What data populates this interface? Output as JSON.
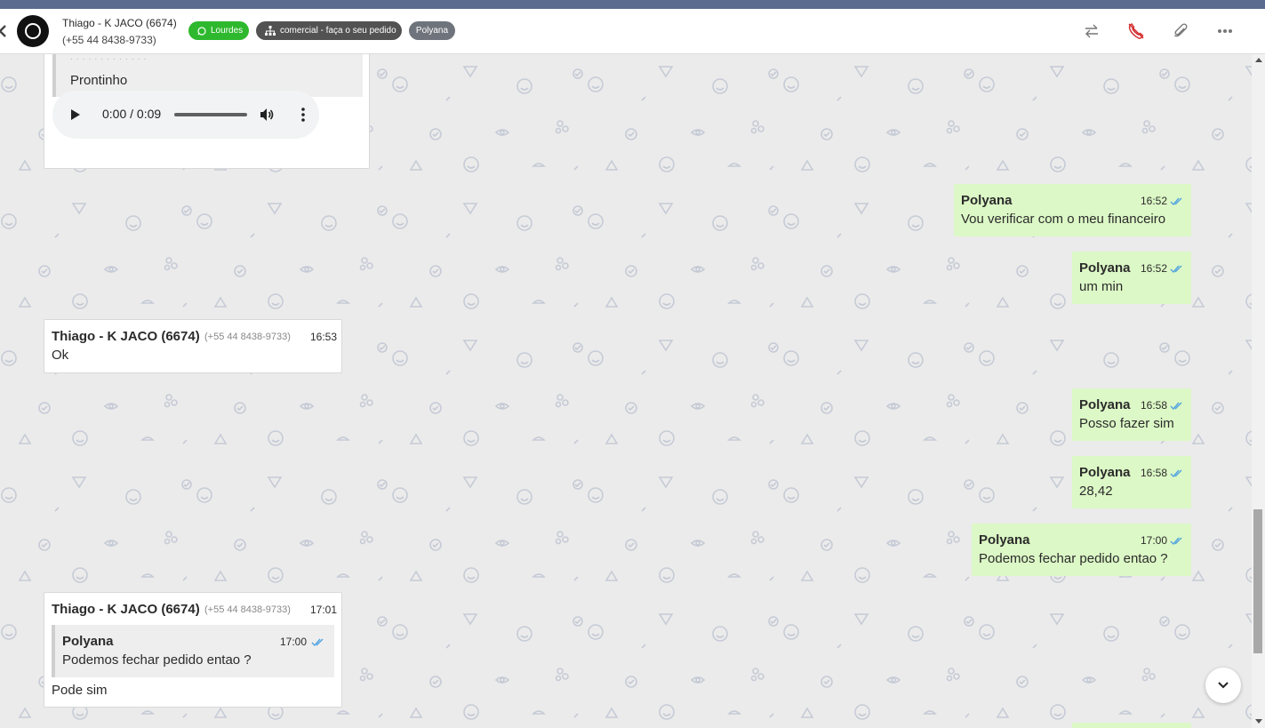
{
  "header": {
    "contact_name": "Thiago - K JACO (6674)",
    "contact_phone": "(+55 44 8438-9733)",
    "badges": {
      "connection": "Lourdes",
      "queue": "comercial - faça o seu pedido",
      "user": "Polyana"
    },
    "actions": [
      "transfer-icon",
      "end-call-icon",
      "paperclip-icon",
      "more-icon"
    ]
  },
  "colors": {
    "outgoing_bubble": "#dcf8c6",
    "incoming_bubble": "#ffffff",
    "read_ticks": "#4fa3e0",
    "whatsapp_badge": "#2eb82e"
  },
  "messages": [
    {
      "id": "m0",
      "direction": "in",
      "quote_text": "Prontinho",
      "audio_time": "0:00 / 0:09"
    },
    {
      "id": "m1",
      "direction": "out",
      "sender": "Polyana",
      "time": "16:52",
      "text": "Vou verificar com o meu financeiro"
    },
    {
      "id": "m2",
      "direction": "out",
      "sender": "Polyana",
      "time": "16:52",
      "text": "um min"
    },
    {
      "id": "m3",
      "direction": "in",
      "sender": "Thiago - K JACO (6674)",
      "phone": "(+55 44 8438-9733)",
      "time": "16:53",
      "text": "Ok"
    },
    {
      "id": "m4",
      "direction": "out",
      "sender": "Polyana",
      "time": "16:58",
      "text": "Posso fazer sim"
    },
    {
      "id": "m5",
      "direction": "out",
      "sender": "Polyana",
      "time": "16:58",
      "text": "28,42"
    },
    {
      "id": "m6",
      "direction": "out",
      "sender": "Polyana",
      "time": "17:00",
      "text": "Podemos fechar pedido entao ?"
    },
    {
      "id": "m7",
      "direction": "in",
      "sender": "Thiago - K JACO (6674)",
      "phone": "(+55 44 8438-9733)",
      "time": "17:01",
      "quote": {
        "sender": "Polyana",
        "time": "17:00",
        "text": "Podemos fechar pedido entao ?"
      },
      "text": "Pode sim"
    }
  ]
}
